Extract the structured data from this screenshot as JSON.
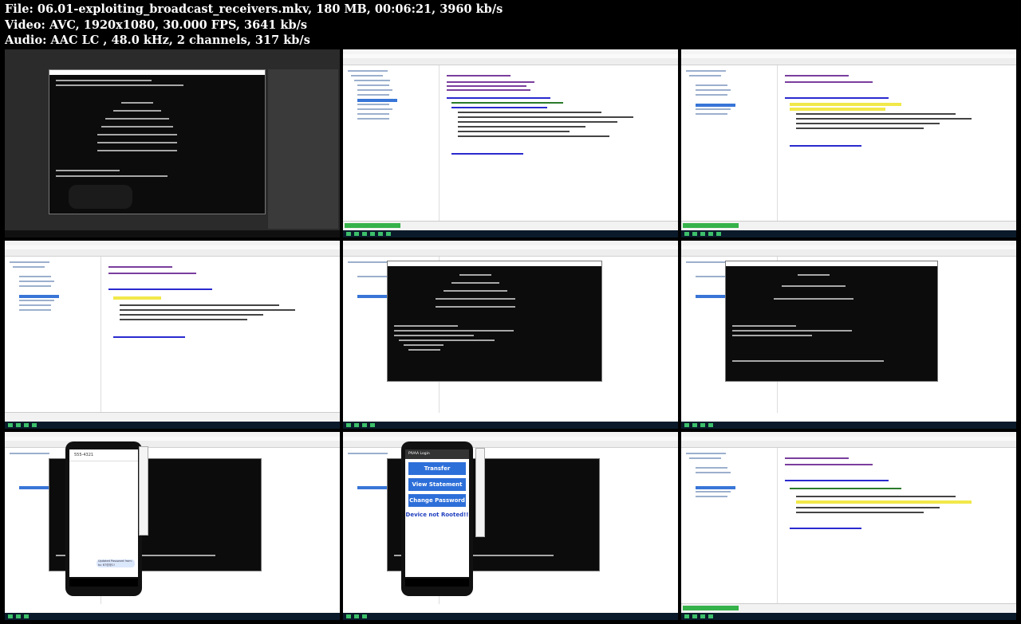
{
  "file_info": {
    "line1": "File: 06.01-exploiting_broadcast_receivers.mkv, 180 MB, 00:06:21, 3960 kb/s",
    "line2": "Video: AVC, 1920x1080, 30.000 FPS, 3641 kb/s",
    "line3": "Audio: AAC LC , 48.0 kHz, 2 channels, 317 kb/s"
  },
  "thumbnails": [
    {
      "scene": "desktop-terminal-emulator"
    },
    {
      "scene": "ide-code"
    },
    {
      "scene": "ide-code-highlight"
    },
    {
      "scene": "ide-code-tree"
    },
    {
      "scene": "terminal-drozer"
    },
    {
      "scene": "terminal-drozer-2"
    },
    {
      "scene": "phone-sms",
      "sms_header": "555-4321",
      "sms_bubble": "Updated Password from: to: 67@@1!"
    },
    {
      "scene": "phone-pivaa",
      "app_title": "PIVAA Login",
      "buttons": [
        "Transfer",
        "View Statement",
        "Change Password"
      ],
      "status_text": "Device not Rooted!!"
    },
    {
      "scene": "ide-code-final"
    }
  ],
  "colors": {
    "accent_blue": "#2d6fd9",
    "taskbar": "#0a1a2a",
    "progress_green": "#35b24a"
  }
}
